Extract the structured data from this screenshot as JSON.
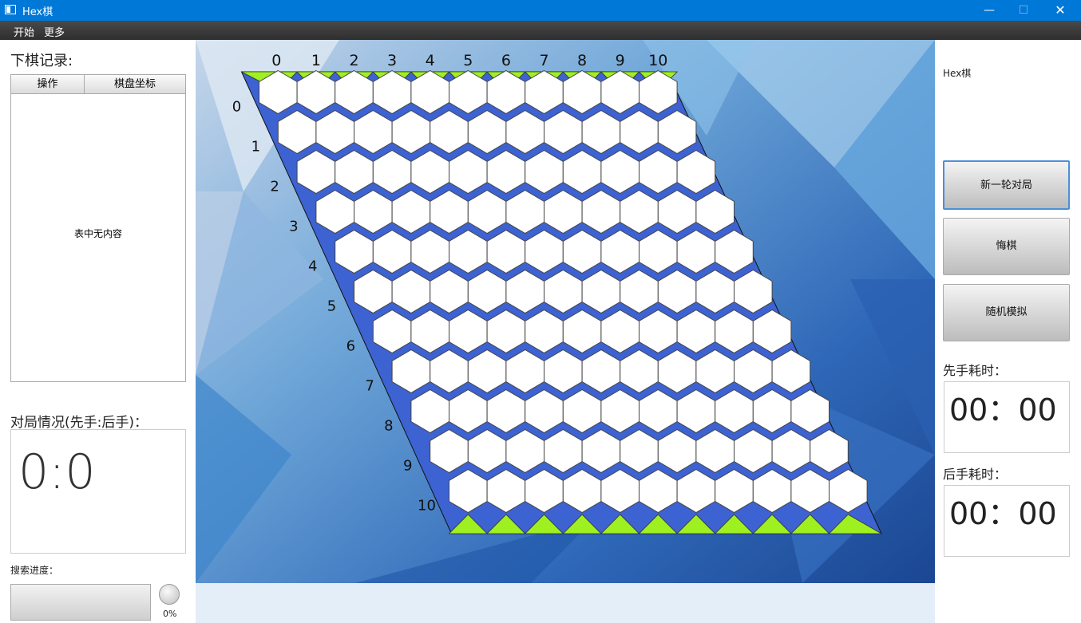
{
  "window": {
    "title": "Hex棋",
    "minimize": "—",
    "maximize": "☐",
    "close": "✕"
  },
  "menu": {
    "items": [
      "开始",
      "更多"
    ]
  },
  "left": {
    "record_title": "下棋记录:",
    "table": {
      "col1": "操作",
      "col2": "棋盘坐标",
      "empty": "表中无内容"
    },
    "score_title": "对局情况(先手:后手)：",
    "score": "0:0",
    "search_label": "搜索进度：",
    "progress_value": 0,
    "progress_text": "0%"
  },
  "board": {
    "size": 11,
    "column_labels": [
      "0",
      "1",
      "2",
      "3",
      "4",
      "5",
      "6",
      "7",
      "8",
      "9",
      "10"
    ],
    "row_labels": [
      "0",
      "1",
      "2",
      "3",
      "4",
      "5",
      "6",
      "7",
      "8",
      "9",
      "10"
    ],
    "colors": {
      "green": "#9ff021",
      "blue": "#3d62d1",
      "cell": "#ffffff"
    }
  },
  "right": {
    "heading": "Hex棋",
    "buttons": [
      "新一轮对局",
      "悔棋",
      "随机模拟"
    ],
    "first_label": "先手耗时：",
    "first_time": "00：00",
    "second_label": "后手耗时：",
    "second_time": "00：00"
  }
}
